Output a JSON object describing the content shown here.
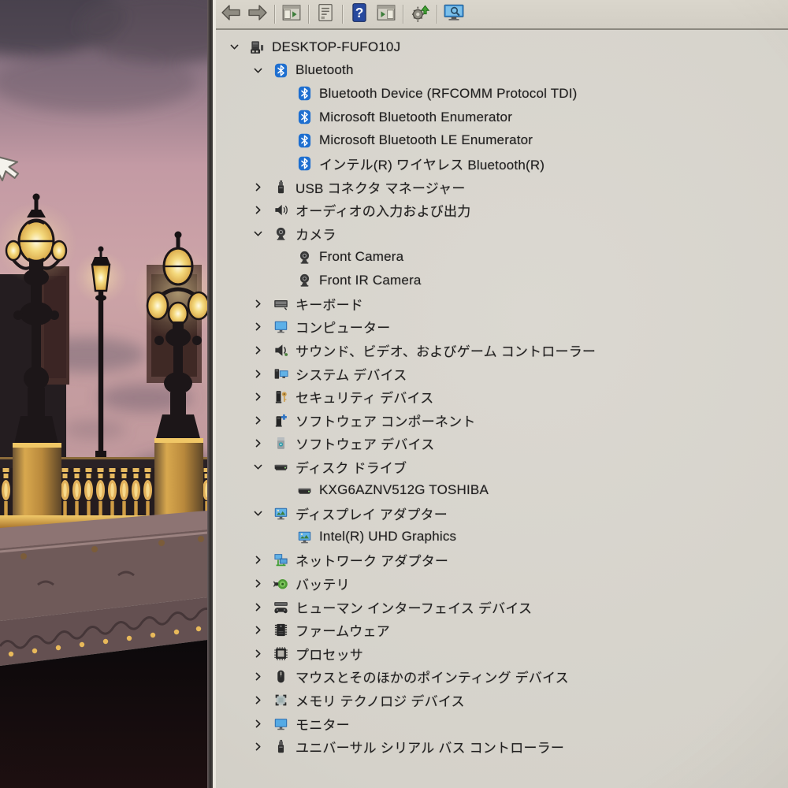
{
  "window": {
    "app": "Device Manager (MMC)",
    "toolbar": [
      {
        "name": "back-button",
        "icon": "back-arrow-icon",
        "interactable": true
      },
      {
        "name": "forward-button",
        "icon": "forward-arrow-icon",
        "interactable": true
      },
      {
        "name": "separator"
      },
      {
        "name": "console-tree-toggle-button",
        "icon": "console-tree-icon",
        "interactable": true
      },
      {
        "name": "separator"
      },
      {
        "name": "properties-button",
        "icon": "properties-icon",
        "interactable": true
      },
      {
        "name": "separator"
      },
      {
        "name": "help-button",
        "icon": "help-icon",
        "interactable": true
      },
      {
        "name": "action-pane-button",
        "icon": "action-pane-icon",
        "interactable": true
      },
      {
        "name": "separator"
      },
      {
        "name": "update-driver-button",
        "icon": "update-driver-icon",
        "interactable": true
      },
      {
        "name": "separator"
      },
      {
        "name": "scan-hardware-button",
        "icon": "scan-hardware-icon",
        "interactable": true
      }
    ]
  },
  "tree": {
    "rows": [
      {
        "label": "DESKTOP-FUFO10J",
        "level": 0,
        "state": "expanded",
        "icon": "computer-icon"
      },
      {
        "label": "Bluetooth",
        "level": 1,
        "state": "expanded",
        "icon": "bluetooth-icon"
      },
      {
        "label": "Bluetooth Device (RFCOMM Protocol TDI)",
        "level": 2,
        "state": "none",
        "icon": "bluetooth-icon"
      },
      {
        "label": "Microsoft Bluetooth Enumerator",
        "level": 2,
        "state": "none",
        "icon": "bluetooth-icon"
      },
      {
        "label": "Microsoft Bluetooth LE Enumerator",
        "level": 2,
        "state": "none",
        "icon": "bluetooth-icon"
      },
      {
        "label": "インテル(R) ワイヤレス Bluetooth(R)",
        "level": 2,
        "state": "none",
        "icon": "bluetooth-icon"
      },
      {
        "label": "USB コネクタ マネージャー",
        "level": 1,
        "state": "collapsed",
        "icon": "usb-connector-icon"
      },
      {
        "label": "オーディオの入力および出力",
        "level": 1,
        "state": "collapsed",
        "icon": "audio-inputs-icon"
      },
      {
        "label": "カメラ",
        "level": 1,
        "state": "expanded",
        "icon": "camera-icon"
      },
      {
        "label": "Front Camera",
        "level": 2,
        "state": "none",
        "icon": "camera-icon"
      },
      {
        "label": "Front IR Camera",
        "level": 2,
        "state": "none",
        "icon": "camera-icon"
      },
      {
        "label": "キーボード",
        "level": 1,
        "state": "collapsed",
        "icon": "keyboard-icon"
      },
      {
        "label": "コンピューター",
        "level": 1,
        "state": "collapsed",
        "icon": "computer-monitor-icon"
      },
      {
        "label": "サウンド、ビデオ、およびゲーム コントローラー",
        "level": 1,
        "state": "collapsed",
        "icon": "sound-controller-icon"
      },
      {
        "label": "システム デバイス",
        "level": 1,
        "state": "collapsed",
        "icon": "system-devices-icon"
      },
      {
        "label": "セキュリティ デバイス",
        "level": 1,
        "state": "collapsed",
        "icon": "security-devices-icon"
      },
      {
        "label": "ソフトウェア コンポーネント",
        "level": 1,
        "state": "collapsed",
        "icon": "software-components-icon"
      },
      {
        "label": "ソフトウェア デバイス",
        "level": 1,
        "state": "collapsed",
        "icon": "software-devices-icon"
      },
      {
        "label": "ディスク ドライブ",
        "level": 1,
        "state": "expanded",
        "icon": "disk-drive-icon"
      },
      {
        "label": "KXG6AZNV512G TOSHIBA",
        "level": 2,
        "state": "none",
        "icon": "disk-drive-icon"
      },
      {
        "label": "ディスプレイ アダプター",
        "level": 1,
        "state": "expanded",
        "icon": "display-adapter-icon"
      },
      {
        "label": "Intel(R) UHD Graphics",
        "level": 2,
        "state": "none",
        "icon": "display-adapter-icon"
      },
      {
        "label": "ネットワーク アダプター",
        "level": 1,
        "state": "collapsed",
        "icon": "network-adapter-icon"
      },
      {
        "label": "バッテリ",
        "level": 1,
        "state": "collapsed",
        "icon": "battery-icon"
      },
      {
        "label": "ヒューマン インターフェイス デバイス",
        "level": 1,
        "state": "collapsed",
        "icon": "hid-icon"
      },
      {
        "label": "ファームウェア",
        "level": 1,
        "state": "collapsed",
        "icon": "firmware-icon"
      },
      {
        "label": "プロセッサ",
        "level": 1,
        "state": "collapsed",
        "icon": "processor-icon"
      },
      {
        "label": "マウスとそのほかのポインティング デバイス",
        "level": 1,
        "state": "collapsed",
        "icon": "mouse-icon"
      },
      {
        "label": "メモリ テクノロジ デバイス",
        "level": 1,
        "state": "collapsed",
        "icon": "memory-technology-icon"
      },
      {
        "label": "モニター",
        "level": 1,
        "state": "collapsed",
        "icon": "monitor-icon"
      },
      {
        "label": "ユニバーサル シリアル バス コントローラー",
        "level": 1,
        "state": "collapsed",
        "icon": "usb-controller-icon"
      }
    ]
  },
  "colors": {
    "panel_bg": "#d6d2ca",
    "toolbar_bg": "#d6d2c7",
    "text": "#201f1f",
    "bluetooth_blue": "#1e6fd0",
    "monitor_blue": "#3d8fd6",
    "battery_green": "#58a73c",
    "lamp_glow_gold": "#f2cb62",
    "sky_pink": "#c9a0a6",
    "sky_purple_top": "#5a4f5c"
  }
}
